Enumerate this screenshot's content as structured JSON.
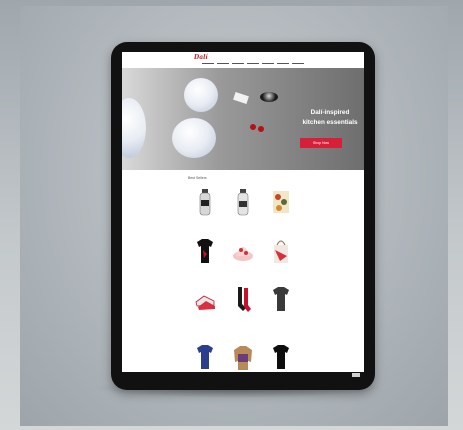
{
  "site": {
    "logo_text": "Dalí",
    "menu_items": [
      "",
      "",
      "",
      "",
      "",
      "",
      ""
    ]
  },
  "hero": {
    "title_line1": "Dalí-inspired",
    "title_line2": "kitchen essentials",
    "button_label": "Shop Now",
    "accent_color": "#d81f3a"
  },
  "section": {
    "label": "Best Sellers"
  },
  "products": [
    {
      "icon": "bottle-icon",
      "caption": ""
    },
    {
      "icon": "bottle-icon",
      "caption": ""
    },
    {
      "icon": "art-print-icon",
      "caption": ""
    },
    {
      "icon": "tshirt-icon",
      "caption": ""
    },
    {
      "icon": "bucket-hat-icon",
      "caption": ""
    },
    {
      "icon": "tote-bag-icon",
      "caption": ""
    },
    {
      "icon": "sneakers-icon",
      "caption": ""
    },
    {
      "icon": "socks-icon",
      "caption": ""
    },
    {
      "icon": "tshirt-icon",
      "caption": ""
    },
    {
      "icon": "tshirt-icon",
      "caption": ""
    },
    {
      "icon": "sweater-icon",
      "caption": ""
    },
    {
      "icon": "tshirt-icon",
      "caption": ""
    }
  ],
  "footer": {
    "text": ""
  }
}
